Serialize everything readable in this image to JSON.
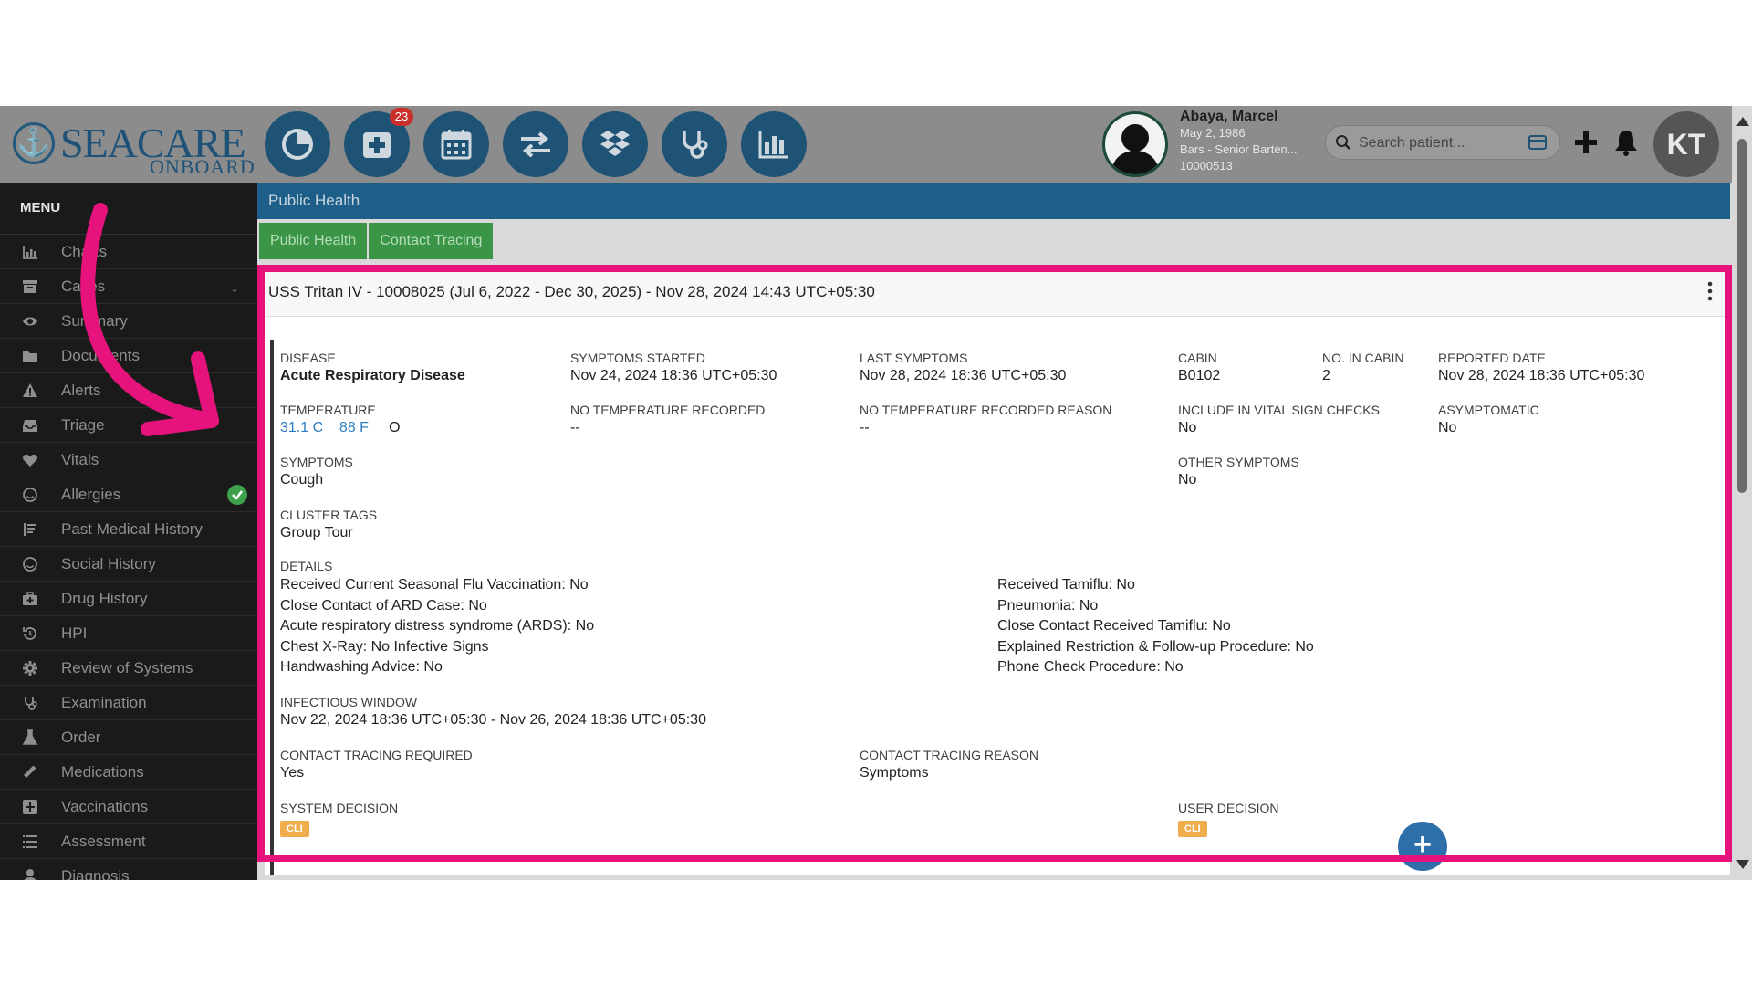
{
  "header": {
    "brand": "SEACARE",
    "brand_sub": "ONBOARD",
    "toolbar_icons": [
      {
        "name": "pie-chart-icon"
      },
      {
        "name": "medical-plus-icon",
        "badge": "23"
      },
      {
        "name": "calendar-icon"
      },
      {
        "name": "transfer-arrows-icon"
      },
      {
        "name": "dropbox-icon"
      },
      {
        "name": "stethoscope-icon"
      },
      {
        "name": "bar-chart-icon"
      }
    ],
    "patient": {
      "name": "Abaya, Marcel",
      "dob": "May 2, 1986",
      "role": "Bars - Senior Barten...",
      "id": "10000513"
    },
    "search_placeholder": "Search patient...",
    "avatar_initials": "KT"
  },
  "sidebar": {
    "title": "MENU",
    "items": [
      {
        "label": "Charts",
        "icon": "bar-chart-icon"
      },
      {
        "label": "Cases",
        "icon": "archive-icon",
        "chevron": true
      },
      {
        "label": "Summary",
        "icon": "eye-icon"
      },
      {
        "label": "Documents",
        "icon": "folder-icon"
      },
      {
        "label": "Alerts",
        "icon": "warning-icon"
      },
      {
        "label": "Triage",
        "icon": "inbox-icon"
      },
      {
        "label": "Vitals",
        "icon": "heart-icon"
      },
      {
        "label": "Allergies",
        "icon": "smile-icon",
        "check": true
      },
      {
        "label": "Past Medical History",
        "icon": "sort-icon"
      },
      {
        "label": "Social History",
        "icon": "smile-icon"
      },
      {
        "label": "Drug History",
        "icon": "medkit-icon"
      },
      {
        "label": "HPI",
        "icon": "history-icon"
      },
      {
        "label": "Review of Systems",
        "icon": "gear-icon"
      },
      {
        "label": "Examination",
        "icon": "stethoscope-icon"
      },
      {
        "label": "Order",
        "icon": "flask-icon"
      },
      {
        "label": "Medications",
        "icon": "pill-icon"
      },
      {
        "label": "Vaccinations",
        "icon": "plus-square-icon"
      },
      {
        "label": "Assessment",
        "icon": "list-icon"
      },
      {
        "label": "Diagnosis",
        "icon": "user-md-icon"
      }
    ]
  },
  "main": {
    "section_title": "Public Health",
    "tabs": [
      "Public Health",
      "Contact Tracing"
    ],
    "card": {
      "title": "USS Tritan IV - 10008025 (Jul 6, 2022 - Dec 30, 2025) - Nov 28, 2024 14:43 UTC+05:30",
      "disease": {
        "label": "DISEASE",
        "value": "Acute Respiratory Disease"
      },
      "symptoms_started": {
        "label": "SYMPTOMS STARTED",
        "value": "Nov 24, 2024 18:36 UTC+05:30"
      },
      "last_symptoms": {
        "label": "LAST SYMPTOMS",
        "value": "Nov 28, 2024 18:36 UTC+05:30"
      },
      "cabin": {
        "label": "CABIN",
        "value": "B0102"
      },
      "no_in_cabin": {
        "label": "NO. IN CABIN",
        "value": "2"
      },
      "reported_date": {
        "label": "REPORTED DATE",
        "value": "Nov 28, 2024 18:36 UTC+05:30"
      },
      "temperature": {
        "label": "TEMPERATURE",
        "celsius": "31.1 C",
        "fahrenheit": "88 F",
        "method": "O"
      },
      "no_temp_recorded": {
        "label": "NO TEMPERATURE RECORDED",
        "value": "--"
      },
      "no_temp_reason": {
        "label": "NO TEMPERATURE RECORDED REASON",
        "value": "--"
      },
      "vital_checks": {
        "label": "INCLUDE IN VITAL SIGN CHECKS",
        "value": "No"
      },
      "asymptomatic": {
        "label": "ASYMPTOMATIC",
        "value": "No"
      },
      "symptoms": {
        "label": "SYMPTOMS",
        "value": "Cough"
      },
      "other_symptoms": {
        "label": "OTHER SYMPTOMS",
        "value": "No"
      },
      "cluster_tags": {
        "label": "CLUSTER TAGS",
        "value": "Group Tour"
      },
      "details": {
        "label": "DETAILS",
        "left": [
          "Received Current Seasonal Flu Vaccination: No",
          "Close Contact of ARD Case: No",
          "Acute respiratory distress syndrome (ARDS): No",
          "Chest X-Ray: No Infective Signs",
          "Handwashing Advice: No"
        ],
        "right": [
          "Received Tamiflu: No",
          "Pneumonia: No",
          "Close Contact Received Tamiflu: No",
          "Explained Restriction & Follow-up Procedure: No",
          "Phone Check Procedure: No"
        ]
      },
      "infectious_window": {
        "label": "INFECTIOUS WINDOW",
        "value": "Nov 22, 2024 18:36 UTC+05:30 - Nov 26, 2024 18:36 UTC+05:30"
      },
      "contact_tracing_required": {
        "label": "CONTACT TRACING REQUIRED",
        "value": "Yes"
      },
      "contact_tracing_reason": {
        "label": "CONTACT TRACING REASON",
        "value": "Symptoms"
      },
      "system_decision": {
        "label": "SYSTEM DECISION",
        "tag": "CLI"
      },
      "user_decision": {
        "label": "USER DECISION",
        "tag": "CLI"
      }
    },
    "fab_label": "+"
  },
  "colors": {
    "brand": "#1e5278",
    "section_bar": "#1d5f88",
    "tab_green": "#3b9546",
    "annotation_pink": "#e6137d",
    "tag_orange": "#f0ad4e"
  }
}
